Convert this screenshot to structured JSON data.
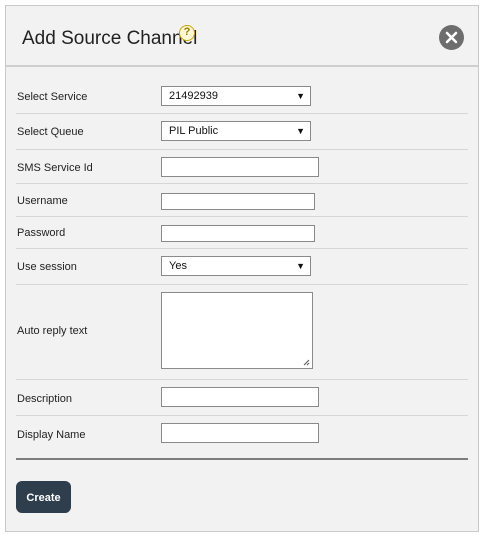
{
  "dialog": {
    "title": "Add Source Channel",
    "help_icon_glyph": "?",
    "help_icon": "question-icon",
    "close_icon": "close-icon"
  },
  "form": {
    "select_service": {
      "label": "Select Service",
      "value": "21492939"
    },
    "select_queue": {
      "label": "Select Queue",
      "value": "PIL Public"
    },
    "sms_service_id": {
      "label": "SMS Service Id",
      "value": "",
      "placeholder": ""
    },
    "username": {
      "label": "Username",
      "value": "",
      "placeholder": ""
    },
    "password": {
      "label": "Password",
      "value": "",
      "placeholder": ""
    },
    "use_session": {
      "label": "Use session",
      "value": "Yes"
    },
    "auto_reply_text": {
      "label": "Auto reply text",
      "value": ""
    },
    "description": {
      "label": "Description",
      "value": ""
    },
    "display_name": {
      "label": "Display Name",
      "value": ""
    }
  },
  "actions": {
    "create_label": "Create"
  },
  "colors": {
    "dialog_bg": "#f2f2f2",
    "button_bg": "#2e3e4d",
    "close_bg": "#6d6d6d"
  }
}
